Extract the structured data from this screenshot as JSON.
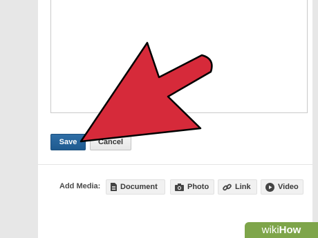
{
  "editor": {
    "save_label": "Save",
    "cancel_label": "Cancel"
  },
  "media": {
    "label": "Add Media:",
    "items": [
      {
        "label": "Document",
        "icon": "document-icon"
      },
      {
        "label": "Photo",
        "icon": "camera-icon"
      },
      {
        "label": "Link",
        "icon": "link-icon"
      },
      {
        "label": "Video",
        "icon": "play-icon"
      }
    ]
  },
  "annotation": {
    "arrow_color": "#d62a3a"
  },
  "watermark": {
    "wiki": "wiki",
    "how": "How"
  },
  "colors": {
    "save_button": "#2a6aa3",
    "gutter": "#e7e7e7",
    "watermark": "#7ea54a"
  }
}
